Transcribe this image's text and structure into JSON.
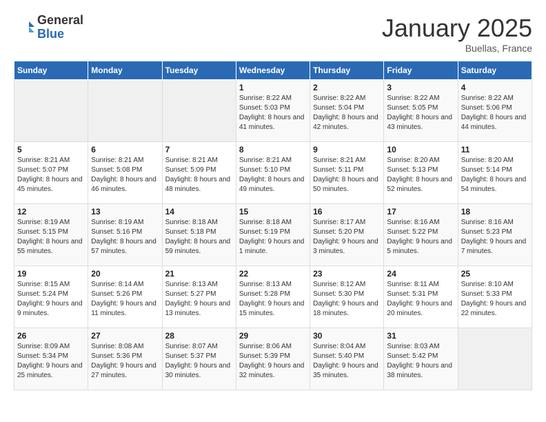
{
  "logo": {
    "general": "General",
    "blue": "Blue"
  },
  "title": "January 2025",
  "location": "Buellas, France",
  "days_header": [
    "Sunday",
    "Monday",
    "Tuesday",
    "Wednesday",
    "Thursday",
    "Friday",
    "Saturday"
  ],
  "weeks": [
    [
      {
        "day": "",
        "sunrise": "",
        "sunset": "",
        "daylight": ""
      },
      {
        "day": "",
        "sunrise": "",
        "sunset": "",
        "daylight": ""
      },
      {
        "day": "",
        "sunrise": "",
        "sunset": "",
        "daylight": ""
      },
      {
        "day": "1",
        "sunrise": "Sunrise: 8:22 AM",
        "sunset": "Sunset: 5:03 PM",
        "daylight": "Daylight: 8 hours and 41 minutes."
      },
      {
        "day": "2",
        "sunrise": "Sunrise: 8:22 AM",
        "sunset": "Sunset: 5:04 PM",
        "daylight": "Daylight: 8 hours and 42 minutes."
      },
      {
        "day": "3",
        "sunrise": "Sunrise: 8:22 AM",
        "sunset": "Sunset: 5:05 PM",
        "daylight": "Daylight: 8 hours and 43 minutes."
      },
      {
        "day": "4",
        "sunrise": "Sunrise: 8:22 AM",
        "sunset": "Sunset: 5:06 PM",
        "daylight": "Daylight: 8 hours and 44 minutes."
      }
    ],
    [
      {
        "day": "5",
        "sunrise": "Sunrise: 8:21 AM",
        "sunset": "Sunset: 5:07 PM",
        "daylight": "Daylight: 8 hours and 45 minutes."
      },
      {
        "day": "6",
        "sunrise": "Sunrise: 8:21 AM",
        "sunset": "Sunset: 5:08 PM",
        "daylight": "Daylight: 8 hours and 46 minutes."
      },
      {
        "day": "7",
        "sunrise": "Sunrise: 8:21 AM",
        "sunset": "Sunset: 5:09 PM",
        "daylight": "Daylight: 8 hours and 48 minutes."
      },
      {
        "day": "8",
        "sunrise": "Sunrise: 8:21 AM",
        "sunset": "Sunset: 5:10 PM",
        "daylight": "Daylight: 8 hours and 49 minutes."
      },
      {
        "day": "9",
        "sunrise": "Sunrise: 8:21 AM",
        "sunset": "Sunset: 5:11 PM",
        "daylight": "Daylight: 8 hours and 50 minutes."
      },
      {
        "day": "10",
        "sunrise": "Sunrise: 8:20 AM",
        "sunset": "Sunset: 5:13 PM",
        "daylight": "Daylight: 8 hours and 52 minutes."
      },
      {
        "day": "11",
        "sunrise": "Sunrise: 8:20 AM",
        "sunset": "Sunset: 5:14 PM",
        "daylight": "Daylight: 8 hours and 54 minutes."
      }
    ],
    [
      {
        "day": "12",
        "sunrise": "Sunrise: 8:19 AM",
        "sunset": "Sunset: 5:15 PM",
        "daylight": "Daylight: 8 hours and 55 minutes."
      },
      {
        "day": "13",
        "sunrise": "Sunrise: 8:19 AM",
        "sunset": "Sunset: 5:16 PM",
        "daylight": "Daylight: 8 hours and 57 minutes."
      },
      {
        "day": "14",
        "sunrise": "Sunrise: 8:18 AM",
        "sunset": "Sunset: 5:18 PM",
        "daylight": "Daylight: 8 hours and 59 minutes."
      },
      {
        "day": "15",
        "sunrise": "Sunrise: 8:18 AM",
        "sunset": "Sunset: 5:19 PM",
        "daylight": "Daylight: 9 hours and 1 minute."
      },
      {
        "day": "16",
        "sunrise": "Sunrise: 8:17 AM",
        "sunset": "Sunset: 5:20 PM",
        "daylight": "Daylight: 9 hours and 3 minutes."
      },
      {
        "day": "17",
        "sunrise": "Sunrise: 8:16 AM",
        "sunset": "Sunset: 5:22 PM",
        "daylight": "Daylight: 9 hours and 5 minutes."
      },
      {
        "day": "18",
        "sunrise": "Sunrise: 8:16 AM",
        "sunset": "Sunset: 5:23 PM",
        "daylight": "Daylight: 9 hours and 7 minutes."
      }
    ],
    [
      {
        "day": "19",
        "sunrise": "Sunrise: 8:15 AM",
        "sunset": "Sunset: 5:24 PM",
        "daylight": "Daylight: 9 hours and 9 minutes."
      },
      {
        "day": "20",
        "sunrise": "Sunrise: 8:14 AM",
        "sunset": "Sunset: 5:26 PM",
        "daylight": "Daylight: 9 hours and 11 minutes."
      },
      {
        "day": "21",
        "sunrise": "Sunrise: 8:13 AM",
        "sunset": "Sunset: 5:27 PM",
        "daylight": "Daylight: 9 hours and 13 minutes."
      },
      {
        "day": "22",
        "sunrise": "Sunrise: 8:13 AM",
        "sunset": "Sunset: 5:28 PM",
        "daylight": "Daylight: 9 hours and 15 minutes."
      },
      {
        "day": "23",
        "sunrise": "Sunrise: 8:12 AM",
        "sunset": "Sunset: 5:30 PM",
        "daylight": "Daylight: 9 hours and 18 minutes."
      },
      {
        "day": "24",
        "sunrise": "Sunrise: 8:11 AM",
        "sunset": "Sunset: 5:31 PM",
        "daylight": "Daylight: 9 hours and 20 minutes."
      },
      {
        "day": "25",
        "sunrise": "Sunrise: 8:10 AM",
        "sunset": "Sunset: 5:33 PM",
        "daylight": "Daylight: 9 hours and 22 minutes."
      }
    ],
    [
      {
        "day": "26",
        "sunrise": "Sunrise: 8:09 AM",
        "sunset": "Sunset: 5:34 PM",
        "daylight": "Daylight: 9 hours and 25 minutes."
      },
      {
        "day": "27",
        "sunrise": "Sunrise: 8:08 AM",
        "sunset": "Sunset: 5:36 PM",
        "daylight": "Daylight: 9 hours and 27 minutes."
      },
      {
        "day": "28",
        "sunrise": "Sunrise: 8:07 AM",
        "sunset": "Sunset: 5:37 PM",
        "daylight": "Daylight: 9 hours and 30 minutes."
      },
      {
        "day": "29",
        "sunrise": "Sunrise: 8:06 AM",
        "sunset": "Sunset: 5:39 PM",
        "daylight": "Daylight: 9 hours and 32 minutes."
      },
      {
        "day": "30",
        "sunrise": "Sunrise: 8:04 AM",
        "sunset": "Sunset: 5:40 PM",
        "daylight": "Daylight: 9 hours and 35 minutes."
      },
      {
        "day": "31",
        "sunrise": "Sunrise: 8:03 AM",
        "sunset": "Sunset: 5:42 PM",
        "daylight": "Daylight: 9 hours and 38 minutes."
      },
      {
        "day": "",
        "sunrise": "",
        "sunset": "",
        "daylight": ""
      }
    ]
  ]
}
